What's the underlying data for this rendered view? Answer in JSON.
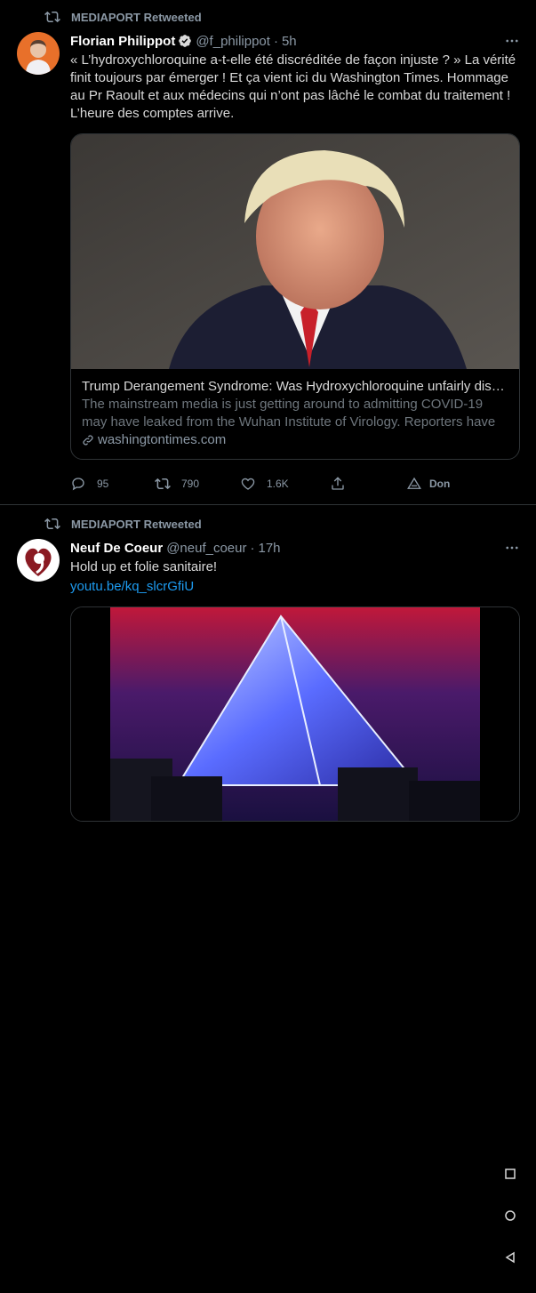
{
  "tweets": [
    {
      "retweeted_by": "MEDIAPORT Retweeted",
      "author_name": "Florian Philippot",
      "author_handle": "@f_philippot",
      "separator": "·",
      "time": "5h",
      "verified": true,
      "text": "« L’hydroxychloroquine a-t-elle été discréditée de façon injuste ? » La vérité finit toujours par émerger ! Et ça vient ici du Washington Times. Hommage au Pr Raoult et aux médecins qui n’ont pas lâché le combat du traitement ! L’heure des comptes arrive.",
      "card": {
        "title": "Trump Derangement Syndrome: Was Hydroxychloroquine unfairly discr...",
        "description": "The mainstream media is just getting around to admitting COVID-19 may have leaked from the Wuhan Institute of Virology. Reporters have ...",
        "domain": "washingtontimes.com"
      },
      "actions": {
        "replies": "95",
        "retweets": "790",
        "likes": "1.6K",
        "donate": "Don"
      }
    },
    {
      "retweeted_by": "MEDIAPORT Retweeted",
      "author_name": "Neuf De Coeur",
      "author_handle": "@neuf_coeur",
      "separator": "·",
      "time": "17h",
      "verified": false,
      "text": "Hold up et folie sanitaire!",
      "link": "youtu.be/kq_slcrGfiU"
    }
  ],
  "icons": {
    "retweet": "retweet-icon",
    "verified": "verified-badge-icon",
    "more": "more-options-icon",
    "reply": "reply-icon",
    "like": "heart-icon",
    "share": "share-icon",
    "donate": "tip-icon",
    "link": "link-icon"
  },
  "colors": {
    "background": "#000000",
    "text": "#d9d9d9",
    "secondary": "#8b98a5",
    "link": "#1d9bf0",
    "verified": "#d9d9d9",
    "divider": "#2f3336"
  }
}
